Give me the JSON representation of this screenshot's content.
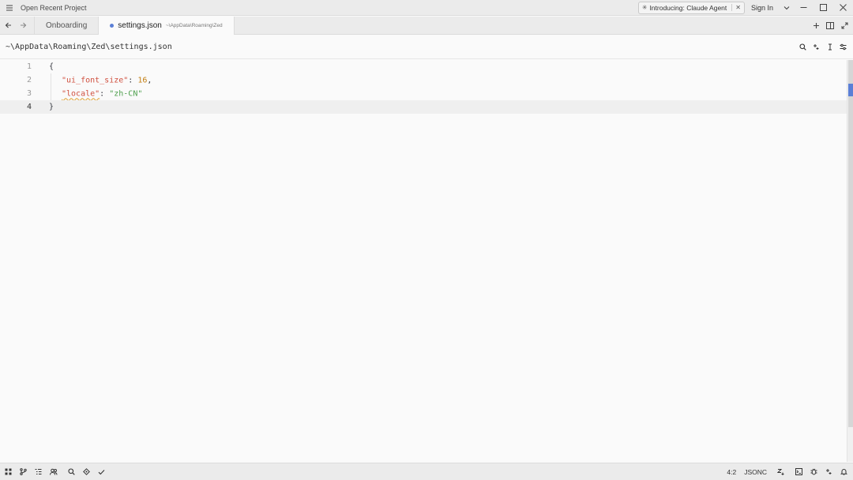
{
  "titlebar": {
    "project_label": "Open Recent Project",
    "announcement": "Introducing: Claude Agent",
    "sign_in": "Sign In"
  },
  "tabs": [
    {
      "label": "Onboarding",
      "path": "",
      "active": false
    },
    {
      "label": "settings.json",
      "path": "~\\AppData\\Roaming\\Zed",
      "active": true,
      "modified": true
    }
  ],
  "breadcrumb": "~\\AppData\\Roaming\\Zed\\settings.json",
  "editor": {
    "lines": [
      {
        "number": "1",
        "text": "{"
      },
      {
        "number": "2",
        "key": "\"ui_font_size\"",
        "value": "16"
      },
      {
        "number": "3",
        "key": "\"locale\"",
        "value": "\"zh-CN\""
      },
      {
        "number": "4",
        "text": "}"
      }
    ],
    "current_line": 4,
    "colors": {
      "key": "#d0503f",
      "number": "#c17d11",
      "string": "#50a14f"
    }
  },
  "statusbar": {
    "cursor": "4:2",
    "language": "JSONC"
  },
  "icons": {
    "titlebar": [
      "menu-icon",
      "minimize-icon",
      "maximize-icon",
      "close-icon"
    ],
    "tabbar": [
      "arrow-left-icon",
      "arrow-right-icon",
      "plus-icon",
      "split-icon",
      "expand-icon"
    ],
    "breadcrumb_tools": [
      "search-icon",
      "sparkle-icon",
      "cursor-icon",
      "sliders-icon"
    ],
    "status_left": [
      "panels-icon",
      "git-branch-icon",
      "outline-icon",
      "collab-icon",
      "search-icon",
      "diagnostics-icon",
      "check-icon"
    ],
    "status_right": [
      "vim-icon",
      "terminal-icon",
      "debug-icon",
      "ai-icon",
      "bell-icon"
    ]
  }
}
